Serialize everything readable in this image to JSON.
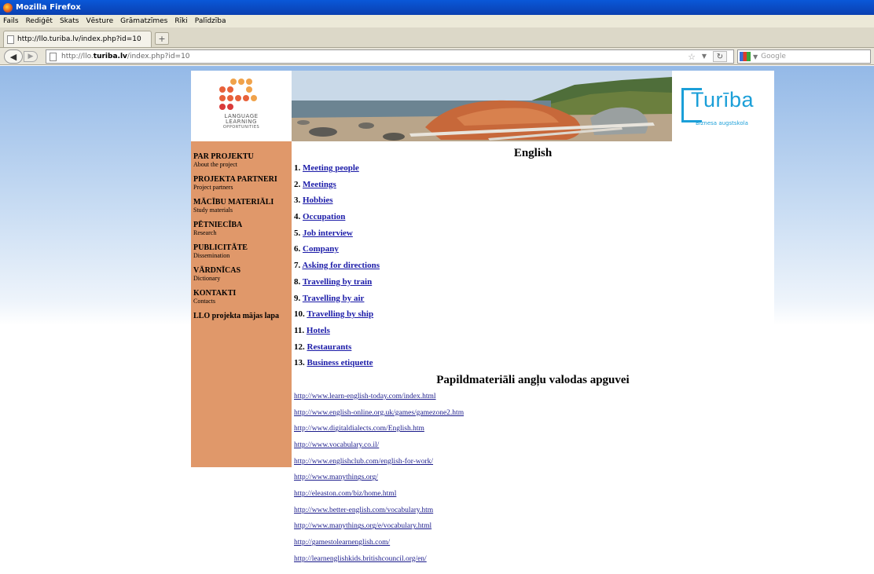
{
  "browser": {
    "window_title": "Mozilla Firefox",
    "menu": [
      "Fails",
      "Rediģēt",
      "Skats",
      "Vēsture",
      "Grāmatzīmes",
      "Rīki",
      "Palīdzība"
    ],
    "tab_title": "http://llo.turiba.lv/index.php?id=10",
    "new_tab_label": "+",
    "url_prefix": "http://llo.",
    "url_domain": "turiba.lv",
    "url_suffix": "/index.php?id=10",
    "search_placeholder": "Google"
  },
  "logo": {
    "line1": "LANGUAGE",
    "line2": "LEARNING",
    "line3": "OPPORTUNITIES",
    "dot_colors": [
      "#f0a24a",
      "#e8613a",
      "#d93a3a"
    ]
  },
  "turiba": {
    "name": "Turība",
    "subtitle": "Biznesa augstskola",
    "color": "#1b9fd8"
  },
  "sidebar": {
    "background": "#e0986a",
    "items": [
      {
        "label": "PAR PROJEKTU",
        "sub": "About the project"
      },
      {
        "label": "PROJEKTA PARTNERI",
        "sub": "Project partners"
      },
      {
        "label": "MĀCĪBU MATERIĀLI",
        "sub": "Study materials"
      },
      {
        "label": "PĒTNIECĪBA",
        "sub": "Research"
      },
      {
        "label": "PUBLICITĀTE",
        "sub": "Dissemination"
      },
      {
        "label": "VĀRDNĪCAS",
        "sub": "Dictionary"
      },
      {
        "label": "KONTAKTI",
        "sub": "Contacts"
      }
    ],
    "home_link": "LLO projekta mājas lapa"
  },
  "main": {
    "title": "English",
    "lessons": [
      {
        "num": "1.",
        "label": "Meeting people"
      },
      {
        "num": "2.",
        "label": "Meetings"
      },
      {
        "num": "3.",
        "label": "Hobbies"
      },
      {
        "num": "4.",
        "label": "Occupation"
      },
      {
        "num": "5.",
        "label": "Job interview"
      },
      {
        "num": "6.",
        "label": "Company"
      },
      {
        "num": "7.",
        "label": "Asking for directions"
      },
      {
        "num": "8.",
        "label": "Travelling by train"
      },
      {
        "num": "9.",
        "label": "Travelling by air"
      },
      {
        "num": "10.",
        "label": "Travelling by ship"
      },
      {
        "num": "11.",
        "label": "Hotels"
      },
      {
        "num": "12.",
        "label": "Restaurants"
      },
      {
        "num": "13.",
        "label": "Business etiquette"
      }
    ],
    "extra_title": "Papildmateriāli angļu valodas apguvei",
    "links": [
      "http://www.learn-english-today.com/index.html",
      "http://www.english-online.org.uk/games/gamezone2.htm",
      "http://www.digitaldialects.com/English.htm",
      "http://www.vocabulary.co.il/",
      "http://www.englishclub.com/english-for-work/",
      "http://www.manythings.org/",
      "http://eleaston.com/biz/home.html",
      "http://www.better-english.com/vocabulary.htm",
      "http://www.manythings.org/e/vocabulary.html",
      "http://gamestolearnenglish.com/",
      "http://learnenglishkids.britishcouncil.org/en/"
    ]
  }
}
